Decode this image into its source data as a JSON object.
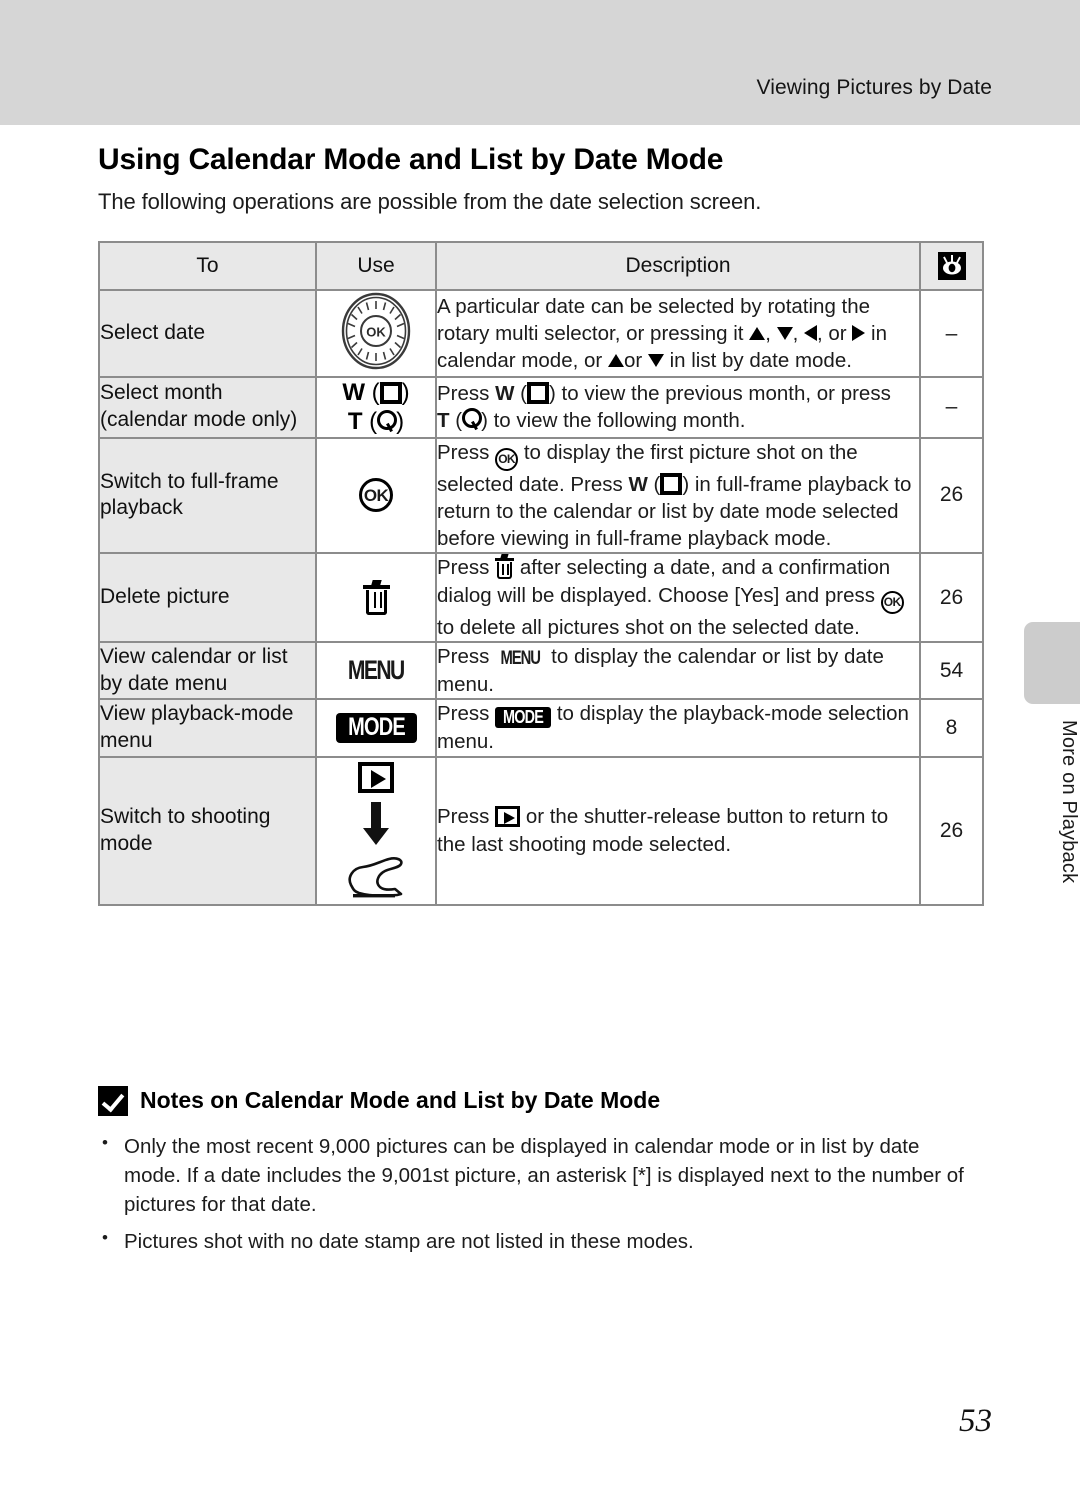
{
  "header": {
    "running_title": "Viewing Pictures by Date"
  },
  "section": {
    "title": "Using Calendar Mode and List by Date Mode",
    "intro": "The following operations are possible from the date selection screen."
  },
  "table": {
    "columns": [
      "To",
      "Use",
      "Description",
      "reference-book-icon"
    ],
    "rows": [
      {
        "to": "Select date",
        "use_icon": "rotary-multi-selector-dial",
        "desc_parts": [
          "A particular date can be selected by rotating the rotary multi selector, or pressing it ",
          "▲",
          ", ",
          "▼",
          ", ",
          "◀",
          ", or ",
          "▶",
          " in calendar mode, or ",
          "▲",
          " or ",
          "▼",
          " in list by date mode."
        ],
        "desc_text": "A particular date can be selected by rotating the rotary multi selector, or pressing it ▲, ▼, ◀, or ▶ in calendar mode, or ▲ or ▼ in list by date mode.",
        "ref": "–"
      },
      {
        "to": "Select month (calendar mode only)",
        "use_label_w": "W",
        "use_label_t": "T",
        "use_icon_w": "thumbnail-checker-icon",
        "use_icon_t": "magnifier-icon",
        "desc_text": "Press W (▦) to view the previous month, or press T (⌕) to view the following month.",
        "ref": "–"
      },
      {
        "to": "Switch to full-frame playback",
        "use_icon": "ok-button",
        "desc_text": "Press ⒪ to display the first picture shot on the selected date. Press W (▦) in full-frame playback to return to the calendar or list by date mode selected before viewing in full-frame playback mode.",
        "ref": "26"
      },
      {
        "to": "Delete picture",
        "use_icon": "trash-icon",
        "desc_text": "Press Ὕ1 after selecting a date, and a confirmation dialog will be displayed. Choose [Yes] and press ⒪ to delete all pictures shot on the selected date.",
        "ref": "26"
      },
      {
        "to": "View calendar or list by date menu",
        "use_icon": "menu-button",
        "use_label": "MENU",
        "desc_text": "Press MENU to display the calendar or list by date menu.",
        "ref": "54"
      },
      {
        "to": "View playback-mode menu",
        "use_icon": "mode-button",
        "use_label": "MODE",
        "desc_text": "Press MODE to display the playback-mode selection menu.",
        "ref": "8"
      },
      {
        "to": "Switch to shooting mode",
        "use_icon": "playback-button-then-shutter-press",
        "desc_text": "Press ▶ or the shutter-release button to return to the last shooting mode selected.",
        "ref": "26"
      }
    ]
  },
  "row_text": {
    "r1_desc_a": "A particular date can be selected by rotating the",
    "r1_desc_b": "rotary multi selector, or pressing it",
    "r1_desc_c": "in calendar mode, or",
    "r1_desc_d": "in list by date",
    "r1_desc_e": "mode.",
    "r2_desc_a": "Press",
    "r2_desc_b": ") to view the previous month, or",
    "r2_desc_c": "press",
    "r2_desc_d": ") to view the following month.",
    "r3_desc_a": "Press",
    "r3_desc_b": "to display the first picture shot on the",
    "r3_desc_c": "selected date.",
    "r3_desc_d": "Press",
    "r3_desc_e": ") in full-frame playback to return to",
    "r3_desc_f": "the calendar or list by date mode selected before",
    "r3_desc_g": "viewing in full-frame playback mode.",
    "r4_desc_a": "Press",
    "r4_desc_b": "after selecting a date, and a confirmation",
    "r4_desc_c": "dialog will be displayed. Choose [Yes] and press",
    "r4_desc_d": "to delete all pictures shot on the selected",
    "r4_desc_e": "date.",
    "r5_desc_a": "Press",
    "r5_desc_b": "to display the calendar or list by date",
    "r5_desc_c": "menu.",
    "r6_desc_a": "Press",
    "r6_desc_b": "to display the playback-mode",
    "r6_desc_c": "selection menu.",
    "r7_desc_a": "Press",
    "r7_desc_b": "or the shutter-release button to return",
    "r7_desc_c": "to the last shooting mode selected."
  },
  "use_labels": {
    "w": "W",
    "t": "T",
    "ok": "OK",
    "menu": "MENU",
    "mode": "MODE",
    "paren_open": "(",
    "paren_close": ")"
  },
  "notes": {
    "heading": "Notes on Calendar Mode and List by Date Mode",
    "items": [
      "Only the most recent 9,000 pictures can be displayed in calendar mode or in list by date mode. If a date includes the 9,001st picture, an asterisk [*] is displayed next to the number of pictures for that date.",
      "Pictures shot with no date stamp are not listed in these modes."
    ]
  },
  "side_tab": {
    "label": "More on Playback"
  },
  "folio": {
    "page_number": "53"
  }
}
